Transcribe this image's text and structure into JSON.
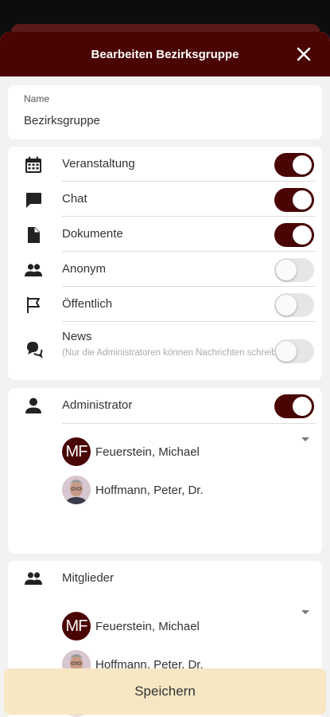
{
  "header": {
    "title": "Bearbeiten Bezirksgruppe",
    "close_icon": "close-icon"
  },
  "name_field": {
    "label": "Name",
    "value": "Bezirksgruppe"
  },
  "options": [
    {
      "key": "veranstaltung",
      "label": "Veranstaltung",
      "icon": "calendar-icon",
      "enabled": true
    },
    {
      "key": "chat",
      "label": "Chat",
      "icon": "chat-bubble-icon",
      "enabled": true
    },
    {
      "key": "dokumente",
      "label": "Dokumente",
      "icon": "document-icon",
      "enabled": true
    },
    {
      "key": "anonym",
      "label": "Anonym",
      "icon": "people-icon",
      "enabled": false
    },
    {
      "key": "oeffentlich",
      "label": "Öffentlich",
      "icon": "flag-icon",
      "enabled": false
    },
    {
      "key": "news",
      "label": "News",
      "sublabel": "(Nur die Administratoren können Nachrichten schreiben)",
      "icon": "news-icon",
      "enabled": false
    }
  ],
  "administrator": {
    "label": "Administrator",
    "icon": "person-icon",
    "enabled": true,
    "people": [
      {
        "initials": "MF",
        "name": "Feuerstein, Michael"
      },
      {
        "initials": "",
        "name": "Hoffmann, Peter, Dr."
      }
    ]
  },
  "members": {
    "label": "Mitglieder",
    "icon": "people-icon",
    "people": [
      {
        "initials": "MF",
        "name": "Feuerstein, Michael"
      },
      {
        "initials": "",
        "name": "Hoffmann, Peter, Dr."
      }
    ]
  },
  "save_button": {
    "label": "Speichern"
  },
  "colors": {
    "primary": "#4a0404",
    "save_bg": "#f7e7c3",
    "background": "#f2f2f2"
  }
}
